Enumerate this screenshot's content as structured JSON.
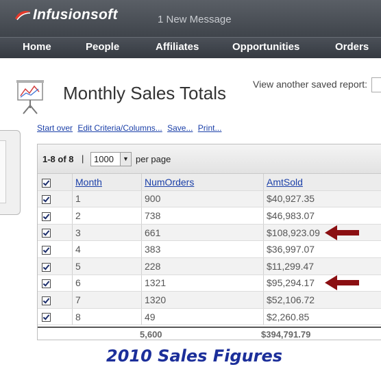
{
  "header": {
    "logo_text": "Infusionsoft",
    "message_text": "1 New Message",
    "nav": [
      "Home",
      "People",
      "Affiliates",
      "Opportunities",
      "Orders"
    ]
  },
  "page": {
    "title": "Monthly Sales Totals",
    "saved_report_label": "View another saved report:",
    "actions": [
      "Start over",
      "Edit Criteria/Columns...",
      "Save...",
      "Print..."
    ]
  },
  "pager": {
    "range": "1-8 of 8",
    "separator": "|",
    "per_page_value": "1000",
    "per_page_label": "per page"
  },
  "table": {
    "columns": [
      "Month",
      "NumOrders",
      "AmtSold"
    ],
    "rows": [
      {
        "month": "1",
        "orders": "900",
        "amt": "$40,927.35",
        "checked": true,
        "flagged": false
      },
      {
        "month": "2",
        "orders": "738",
        "amt": "$46,983.07",
        "checked": true,
        "flagged": false
      },
      {
        "month": "3",
        "orders": "661",
        "amt": "$108,923.09",
        "checked": true,
        "flagged": true
      },
      {
        "month": "4",
        "orders": "383",
        "amt": "$36,997.07",
        "checked": true,
        "flagged": false
      },
      {
        "month": "5",
        "orders": "228",
        "amt": "$11,299.47",
        "checked": true,
        "flagged": false
      },
      {
        "month": "6",
        "orders": "1321",
        "amt": "$95,294.17",
        "checked": true,
        "flagged": true
      },
      {
        "month": "7",
        "orders": "1320",
        "amt": "$52,106.72",
        "checked": true,
        "flagged": false
      },
      {
        "month": "8",
        "orders": "49",
        "amt": "$2,260.85",
        "checked": true,
        "flagged": false
      }
    ],
    "totals": {
      "orders": "5,600",
      "amt": "$394,791.79"
    }
  },
  "caption": "2010 Sales Figures",
  "colors": {
    "accent_arrow": "#8b0f12",
    "link": "#1a3fa8",
    "caption": "#1c2f9a"
  }
}
